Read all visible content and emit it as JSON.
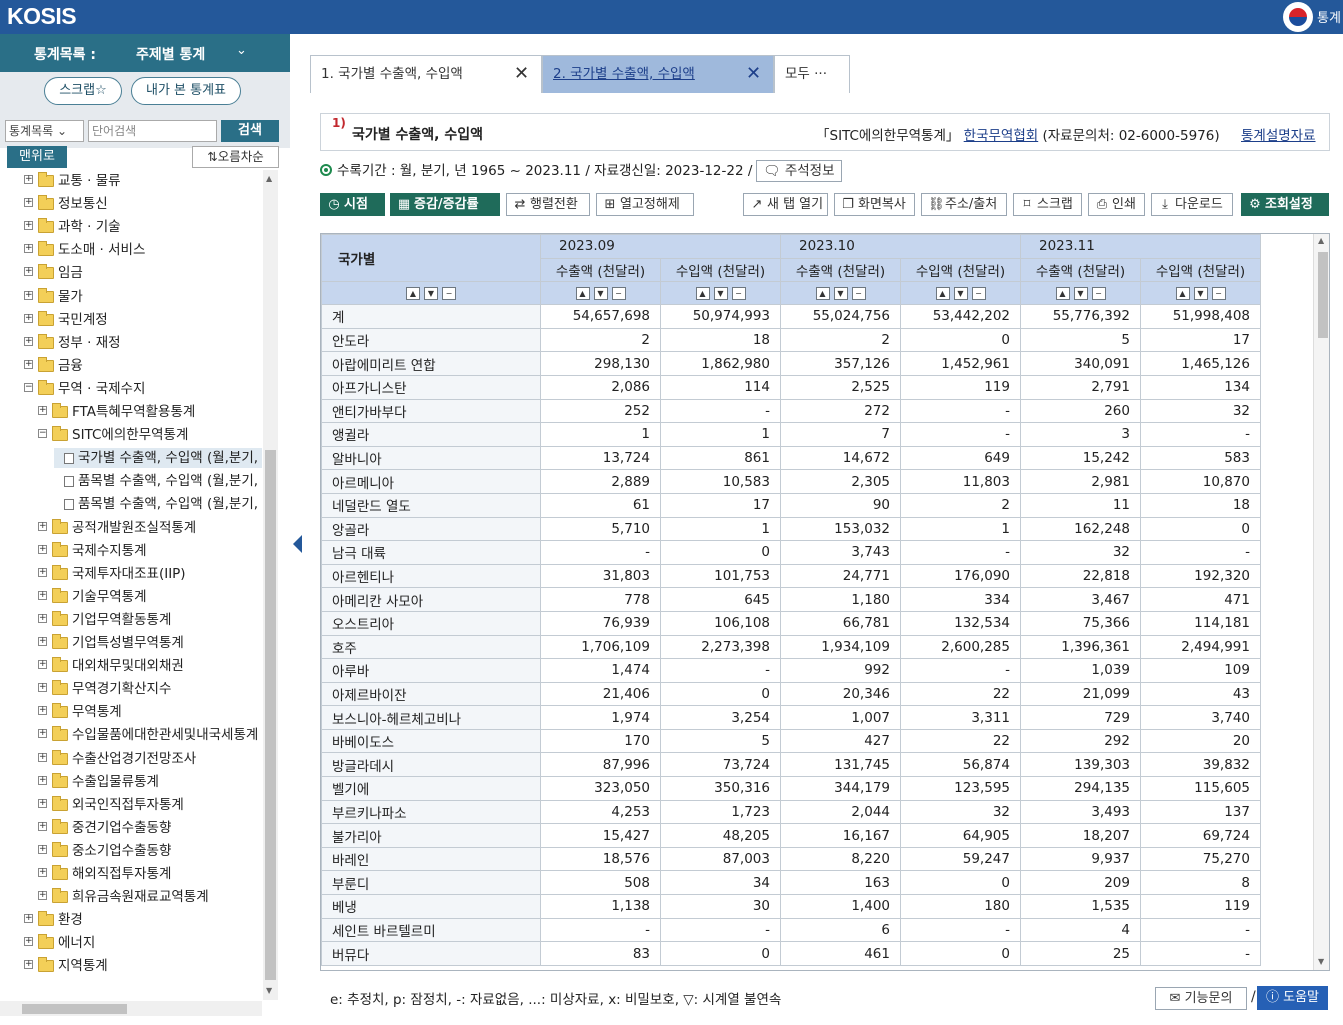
{
  "header": {
    "logo": "KOSIS",
    "right_text": "통계"
  },
  "left_panel": {
    "title_label": "통계목록 :",
    "category": "주제별 통계",
    "scrap_btn": "스크랩☆",
    "recent_btn": "내가 본 통계표",
    "search_select": "통계목록 ⌄",
    "search_placeholder": "단어검색",
    "search_btn": "검색",
    "top_btn": "맨위로",
    "sort_btn": "오름차순",
    "tree": [
      {
        "label": "교통 · 물류",
        "level": 0
      },
      {
        "label": "정보통신",
        "level": 0
      },
      {
        "label": "과학 · 기술",
        "level": 0
      },
      {
        "label": "도소매 · 서비스",
        "level": 0
      },
      {
        "label": "임금",
        "level": 0
      },
      {
        "label": "물가",
        "level": 0
      },
      {
        "label": "국민계정",
        "level": 0
      },
      {
        "label": "정부 · 재정",
        "level": 0
      },
      {
        "label": "금융",
        "level": 0
      },
      {
        "label": "무역 · 국제수지",
        "level": 0,
        "open": true
      },
      {
        "label": "FTA특혜무역활용통계",
        "level": 1
      },
      {
        "label": "SITC에의한무역통계",
        "level": 1,
        "open": true
      },
      {
        "label": "국가별 수출액, 수입액 (월,분기,",
        "level": 2,
        "doc": true,
        "selected": true
      },
      {
        "label": "품목별 수출액, 수입액 (월,분기,",
        "level": 2,
        "doc": true
      },
      {
        "label": "품목별 수출액, 수입액 (월,분기,",
        "level": 2,
        "doc": true
      },
      {
        "label": "공적개발원조실적통계",
        "level": 1
      },
      {
        "label": "국제수지통계",
        "level": 1
      },
      {
        "label": "국제투자대조표(IIP)",
        "level": 1
      },
      {
        "label": "기술무역통계",
        "level": 1
      },
      {
        "label": "기업무역활동통계",
        "level": 1
      },
      {
        "label": "기업특성별무역통계",
        "level": 1
      },
      {
        "label": "대외채무및대외채권",
        "level": 1
      },
      {
        "label": "무역경기확산지수",
        "level": 1
      },
      {
        "label": "무역통계",
        "level": 1
      },
      {
        "label": "수입물품에대한관세및내국세통계",
        "level": 1
      },
      {
        "label": "수출산업경기전망조사",
        "level": 1
      },
      {
        "label": "수출입물류통계",
        "level": 1
      },
      {
        "label": "외국인직접투자통계",
        "level": 1
      },
      {
        "label": "중견기업수출동향",
        "level": 1
      },
      {
        "label": "중소기업수출동향",
        "level": 1
      },
      {
        "label": "해외직접투자통계",
        "level": 1
      },
      {
        "label": "희유금속원재료교역통계",
        "level": 1
      },
      {
        "label": "환경",
        "level": 0
      },
      {
        "label": "에너지",
        "level": 0
      },
      {
        "label": "지역통계",
        "level": 0
      }
    ]
  },
  "tabs": [
    {
      "label": "1. 국가별 수출액, 수입액"
    },
    {
      "label": "2. 국가별 수출액, 수입액"
    },
    {
      "label": "모두 ···"
    }
  ],
  "table_title": {
    "number": "1)",
    "title": "국가별 수출액, 수입액",
    "source_prefix": "「SITC에의한무역통계」",
    "source_org": "한국무역협회",
    "contact": "(자료문의처: 02-6000-5976)",
    "description_link": "통계설명자료"
  },
  "info": {
    "period": "수록기간 : 월, 분기, 년 1965 ~ 2023.11 / 자료갱신일: 2023-12-22 /",
    "note_btn": "주석정보"
  },
  "toolbar": {
    "view": "시점",
    "change": "증감/증감률",
    "transpose": "행렬전환",
    "unfix": "열고정해제",
    "newtab": "새 탭 열기",
    "capture": "화면복사",
    "url": "주소/출처",
    "scrap": "스크랩",
    "print": "인쇄",
    "download": "다운로드",
    "settings": "조회설정"
  },
  "grid": {
    "corner": "국가별",
    "periods": [
      "2023.09",
      "2023.10",
      "2023.11"
    ],
    "sub_headers": [
      "수출액 (천달러)",
      "수입액 (천달러)",
      "수출액 (천달러)",
      "수입액 (천달러)",
      "수출액 (천달러)",
      "수입액 (천달러)"
    ],
    "rows": [
      {
        "name": "계",
        "values": [
          "54,657,698",
          "50,974,993",
          "55,024,756",
          "53,442,202",
          "55,776,392",
          "51,998,408"
        ]
      },
      {
        "name": "안도라",
        "values": [
          "2",
          "18",
          "2",
          "0",
          "5",
          "17"
        ]
      },
      {
        "name": "아랍에미리트 연합",
        "values": [
          "298,130",
          "1,862,980",
          "357,126",
          "1,452,961",
          "340,091",
          "1,465,126"
        ]
      },
      {
        "name": "아프가니스탄",
        "values": [
          "2,086",
          "114",
          "2,525",
          "119",
          "2,791",
          "134"
        ]
      },
      {
        "name": "앤티가바부다",
        "values": [
          "252",
          "-",
          "272",
          "-",
          "260",
          "32"
        ]
      },
      {
        "name": "앵귈라",
        "values": [
          "1",
          "1",
          "7",
          "-",
          "3",
          "-"
        ]
      },
      {
        "name": "알바니아",
        "values": [
          "13,724",
          "861",
          "14,672",
          "649",
          "15,242",
          "583"
        ]
      },
      {
        "name": "아르메니아",
        "values": [
          "2,889",
          "10,583",
          "2,305",
          "11,803",
          "2,981",
          "10,870"
        ]
      },
      {
        "name": "네덜란드 열도",
        "values": [
          "61",
          "17",
          "90",
          "2",
          "11",
          "18"
        ]
      },
      {
        "name": "앙골라",
        "values": [
          "5,710",
          "1",
          "153,032",
          "1",
          "162,248",
          "0"
        ]
      },
      {
        "name": "남극 대륙",
        "values": [
          "-",
          "0",
          "3,743",
          "-",
          "32",
          "-"
        ]
      },
      {
        "name": "아르헨티나",
        "values": [
          "31,803",
          "101,753",
          "24,771",
          "176,090",
          "22,818",
          "192,320"
        ]
      },
      {
        "name": "아메리칸 사모아",
        "values": [
          "778",
          "645",
          "1,180",
          "334",
          "3,467",
          "471"
        ]
      },
      {
        "name": "오스트리아",
        "values": [
          "76,939",
          "106,108",
          "66,781",
          "132,534",
          "75,366",
          "114,181"
        ]
      },
      {
        "name": "호주",
        "values": [
          "1,706,109",
          "2,273,398",
          "1,934,109",
          "2,600,285",
          "1,396,361",
          "2,494,991"
        ]
      },
      {
        "name": "아루바",
        "values": [
          "1,474",
          "-",
          "992",
          "-",
          "1,039",
          "109"
        ]
      },
      {
        "name": "아제르바이잔",
        "values": [
          "21,406",
          "0",
          "20,346",
          "22",
          "21,099",
          "43"
        ]
      },
      {
        "name": "보스니아-헤르체고비나",
        "values": [
          "1,974",
          "3,254",
          "1,007",
          "3,311",
          "729",
          "3,740"
        ]
      },
      {
        "name": "바베이도스",
        "values": [
          "170",
          "5",
          "427",
          "22",
          "292",
          "20"
        ]
      },
      {
        "name": "방글라데시",
        "values": [
          "87,996",
          "73,724",
          "131,745",
          "56,874",
          "139,303",
          "39,832"
        ]
      },
      {
        "name": "벨기에",
        "values": [
          "323,050",
          "350,316",
          "344,179",
          "123,595",
          "294,135",
          "115,605"
        ]
      },
      {
        "name": "부르키나파소",
        "values": [
          "4,253",
          "1,723",
          "2,044",
          "32",
          "3,493",
          "137"
        ]
      },
      {
        "name": "불가리아",
        "values": [
          "15,427",
          "48,205",
          "16,167",
          "64,905",
          "18,207",
          "69,724"
        ]
      },
      {
        "name": "바레인",
        "values": [
          "18,576",
          "87,003",
          "8,220",
          "59,247",
          "9,937",
          "75,270"
        ]
      },
      {
        "name": "부룬디",
        "values": [
          "508",
          "34",
          "163",
          "0",
          "209",
          "8"
        ]
      },
      {
        "name": "베냉",
        "values": [
          "1,138",
          "30",
          "1,400",
          "180",
          "1,535",
          "119"
        ]
      },
      {
        "name": "세인트 바르텔르미",
        "values": [
          "-",
          "-",
          "6",
          "-",
          "4",
          "-"
        ]
      },
      {
        "name": "버뮤다",
        "values": [
          "83",
          "0",
          "461",
          "0",
          "25",
          "-"
        ]
      }
    ]
  },
  "legend": "e: 추정치, p: 잠정치, -: 자료없음, ...: 미상자료, x: 비밀보호, ▽: 시계열 불연속",
  "footer": {
    "inquiry": "기능문의",
    "separator": "/",
    "help": "도움말"
  },
  "colors": {
    "header": "#24589a",
    "left_header": "#2a6f87",
    "active_tab": "#9fb9dc",
    "grid_header": "#c6d6ee",
    "dark_btn": "#1f6b5a",
    "help_btn": "#2660b5"
  }
}
